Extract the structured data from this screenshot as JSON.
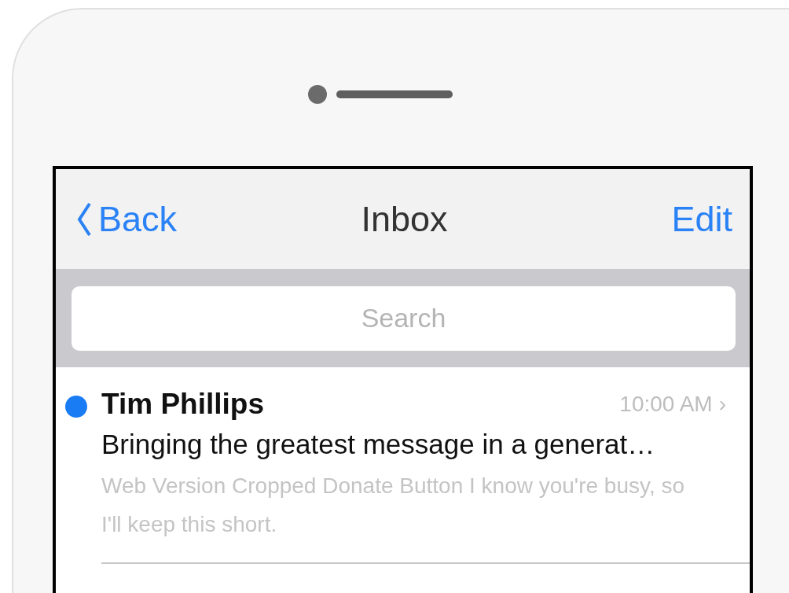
{
  "nav_bar": {
    "back": "Back",
    "title": "Inbox",
    "edit": "Edit"
  },
  "search": {
    "placeholder": "Search"
  },
  "messages": [
    {
      "sender": "Tim Phillips",
      "time": "10:00 AM",
      "chevron": "›",
      "unread": true,
      "subject": "Bringing the greatest message in a generat…",
      "preview": "Web Version Cropped Donate Button I know you're busy, so I'll keep this short."
    }
  ]
}
